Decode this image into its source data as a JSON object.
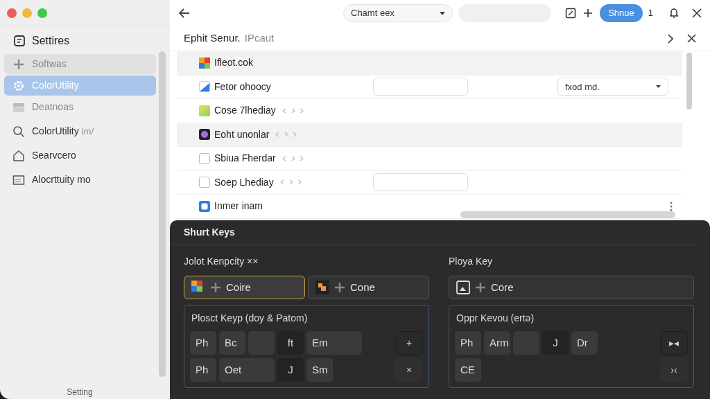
{
  "sidebar": {
    "title": "Settires",
    "items": [
      {
        "label": "Softwas",
        "kind": "plus",
        "selected": false,
        "hovered": true,
        "disabled": true
      },
      {
        "label": "ColorUtility",
        "kind": "gear",
        "selected": true,
        "hovered": false,
        "disabled": false
      },
      {
        "label": "Deatnoas",
        "kind": "box",
        "selected": false,
        "hovered": false,
        "disabled": true
      },
      {
        "label": "ColorUtility",
        "suffix": "im/",
        "kind": "search",
        "selected": false,
        "hovered": false,
        "disabled": false
      },
      {
        "label": "Searvcero",
        "kind": "house",
        "selected": false,
        "hovered": false,
        "disabled": false
      },
      {
        "label": "Alocrttuity mo",
        "kind": "folder",
        "selected": false,
        "hovered": false,
        "disabled": false
      }
    ],
    "footer": "Setting"
  },
  "toolbar": {
    "dropdown": "Chamt eex",
    "button": "Shnue",
    "count": "1"
  },
  "panel": {
    "title": "Ephit Senur.",
    "subtitle": "IPcaut",
    "rows": [
      {
        "label": "Ifleot.cok",
        "kind": "multicolor",
        "highlighted": true,
        "arrows": false,
        "field": false,
        "more": false
      },
      {
        "label": "Fetor ohoocy",
        "kind": "corner",
        "highlighted": false,
        "arrows": false,
        "field": true,
        "dropdown": "fxod md.",
        "more": false
      },
      {
        "label": "Cose 7lhediay",
        "kind": "gradient",
        "highlighted": false,
        "arrows": true,
        "field": false,
        "more": false
      },
      {
        "label": "Eoht unonlar",
        "kind": "swatch",
        "highlighted": true,
        "arrows": true,
        "field": false,
        "more": false
      },
      {
        "label": "Sbiua Fherdar",
        "kind": "checkbox",
        "highlighted": false,
        "arrows": true,
        "field": false,
        "more": false
      },
      {
        "label": "Soep Lhediay",
        "kind": "checkbox",
        "highlighted": false,
        "arrows": true,
        "field": true,
        "more": false
      },
      {
        "label": "Inmer inam",
        "kind": "square",
        "highlighted": false,
        "arrows": false,
        "field": false,
        "more": true
      }
    ]
  },
  "shortcuts": {
    "title": "Shurt Keys",
    "sections": [
      {
        "label": "Jolot Kenpcity ××",
        "chips": [
          {
            "label": "Coire",
            "kind": "multicolor",
            "selected": true
          },
          {
            "label": "Cone",
            "kind": "tiles",
            "selected": false
          }
        ],
        "group": {
          "title": "Plosct Keyp (doy & Patom)",
          "top_keys": [
            {
              "label": "Ph",
              "kind": "key"
            },
            {
              "label": "Bc",
              "kind": "key"
            },
            {
              "kind": "blank"
            },
            {
              "label": "ft",
              "kind": "dark"
            },
            {
              "label": "Em",
              "kind": "wide"
            }
          ],
          "bottom_keys": [
            {
              "label": "Ph",
              "kind": "key"
            },
            {
              "label": "Oet",
              "kind": "wide"
            },
            {
              "label": "J",
              "kind": "dark"
            },
            {
              "label": "Sm",
              "kind": "key"
            }
          ],
          "side": [
            "+",
            "×"
          ]
        }
      },
      {
        "label": "Ploya Key",
        "chips": [
          {
            "label": "Core",
            "kind": "image",
            "selected": false
          }
        ],
        "group": {
          "title": "Oppr Kevou (ertə)",
          "top_keys": [
            {
              "label": "Ph",
              "kind": "key"
            },
            {
              "label": "Arm",
              "kind": "key"
            },
            {
              "kind": "blank"
            },
            {
              "label": "J",
              "kind": "dark"
            },
            {
              "label": "Dr",
              "kind": "key"
            }
          ],
          "bottom_keys": [
            {
              "label": "CE",
              "kind": "key"
            }
          ],
          "side": [
            "▸◂",
            "›‹"
          ]
        }
      }
    ]
  }
}
